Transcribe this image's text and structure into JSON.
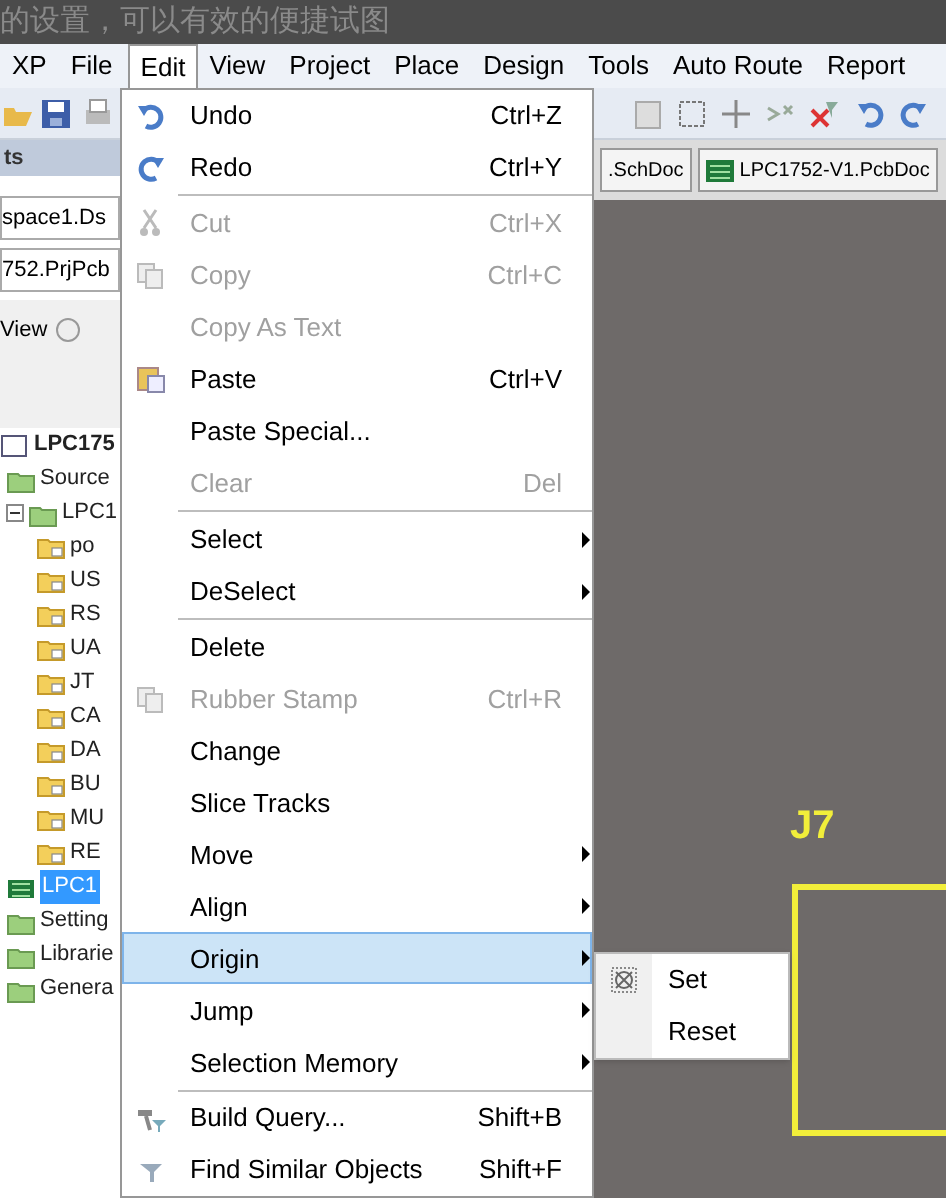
{
  "caption": "的设置，可以有效的便捷试图",
  "menu_bar": [
    {
      "label": "XP",
      "selected": false
    },
    {
      "label": "File",
      "selected": false
    },
    {
      "label": "Edit",
      "selected": true
    },
    {
      "label": "View",
      "selected": false
    },
    {
      "label": "Project",
      "selected": false
    },
    {
      "label": "Place",
      "selected": false
    },
    {
      "label": "Design",
      "selected": false
    },
    {
      "label": "Tools",
      "selected": false
    },
    {
      "label": "Auto Route",
      "selected": false
    },
    {
      "label": "Report",
      "selected": false
    }
  ],
  "panel": {
    "title": "ts",
    "workspace": "space1.Ds",
    "project": "752.PrjPcb",
    "view_label": "View",
    "view_selected": false,
    "tree": [
      {
        "label": "LPC175",
        "kind": "project",
        "selected": false,
        "children": [
          {
            "label": "Source",
            "kind": "folder",
            "selected": false
          },
          {
            "label": "LPC1",
            "kind": "folder",
            "selected": false,
            "expanded": true,
            "children": [
              {
                "label": "po",
                "kind": "doc",
                "selected": false
              },
              {
                "label": "US",
                "kind": "doc",
                "selected": false
              },
              {
                "label": "RS",
                "kind": "doc",
                "selected": false
              },
              {
                "label": "UA",
                "kind": "doc",
                "selected": false
              },
              {
                "label": "JT",
                "kind": "doc",
                "selected": false
              },
              {
                "label": "CA",
                "kind": "doc",
                "selected": false
              },
              {
                "label": "DA",
                "kind": "doc",
                "selected": false
              },
              {
                "label": "BU",
                "kind": "doc",
                "selected": false
              },
              {
                "label": "MU",
                "kind": "doc",
                "selected": false
              },
              {
                "label": "RE",
                "kind": "doc",
                "selected": false
              }
            ]
          },
          {
            "label": "LPC1",
            "kind": "pcb",
            "selected": true
          },
          {
            "label": "Setting",
            "kind": "folder",
            "selected": false
          },
          {
            "label": "Librarie",
            "kind": "folder",
            "selected": false
          },
          {
            "label": "Genera",
            "kind": "folder",
            "selected": false
          }
        ]
      }
    ]
  },
  "doc_tabs": [
    {
      "label": ".SchDoc",
      "kind": "sch"
    },
    {
      "label": "LPC1752-V1.PcbDoc",
      "kind": "pcb"
    }
  ],
  "edit_menu": {
    "groups": [
      [
        {
          "label": "Undo",
          "shortcut": "Ctrl+Z",
          "disabled": false,
          "submenu": false,
          "selected": false
        },
        {
          "label": "Redo",
          "shortcut": "Ctrl+Y",
          "disabled": false,
          "submenu": false,
          "selected": false
        }
      ],
      [
        {
          "label": "Cut",
          "shortcut": "Ctrl+X",
          "disabled": true,
          "submenu": false,
          "selected": false
        },
        {
          "label": "Copy",
          "shortcut": "Ctrl+C",
          "disabled": true,
          "submenu": false,
          "selected": false
        },
        {
          "label": "Copy As Text",
          "disabled": true,
          "submenu": false,
          "selected": false
        },
        {
          "label": "Paste",
          "shortcut": "Ctrl+V",
          "disabled": false,
          "submenu": false,
          "selected": false
        },
        {
          "label": "Paste Special...",
          "disabled": false,
          "submenu": false,
          "selected": false
        },
        {
          "label": "Clear",
          "shortcut": "Del",
          "disabled": true,
          "submenu": false,
          "selected": false
        }
      ],
      [
        {
          "label": "Select",
          "disabled": false,
          "submenu": true,
          "selected": false
        },
        {
          "label": "DeSelect",
          "disabled": false,
          "submenu": true,
          "selected": false
        }
      ],
      [
        {
          "label": "Delete",
          "disabled": false,
          "submenu": false,
          "selected": false
        },
        {
          "label": "Rubber Stamp",
          "shortcut": "Ctrl+R",
          "disabled": true,
          "submenu": false,
          "selected": false
        },
        {
          "label": "Change",
          "disabled": false,
          "submenu": false,
          "selected": false
        },
        {
          "label": "Slice Tracks",
          "disabled": false,
          "submenu": false,
          "selected": false
        },
        {
          "label": "Move",
          "disabled": false,
          "submenu": true,
          "selected": false
        },
        {
          "label": "Align",
          "disabled": false,
          "submenu": true,
          "selected": false
        },
        {
          "label": "Origin",
          "disabled": false,
          "submenu": true,
          "selected": true
        },
        {
          "label": "Jump",
          "disabled": false,
          "submenu": true,
          "selected": false
        },
        {
          "label": "Selection Memory",
          "disabled": false,
          "submenu": true,
          "selected": false
        }
      ],
      [
        {
          "label": "Build Query...",
          "shortcut": "Shift+B",
          "disabled": false,
          "submenu": false,
          "selected": false
        },
        {
          "label": "Find Similar Objects",
          "shortcut": "Shift+F",
          "disabled": false,
          "submenu": false,
          "selected": false
        }
      ]
    ]
  },
  "origin_submenu": [
    {
      "label": "Set"
    },
    {
      "label": "Reset"
    }
  ],
  "canvas": {
    "designator": "J7"
  }
}
